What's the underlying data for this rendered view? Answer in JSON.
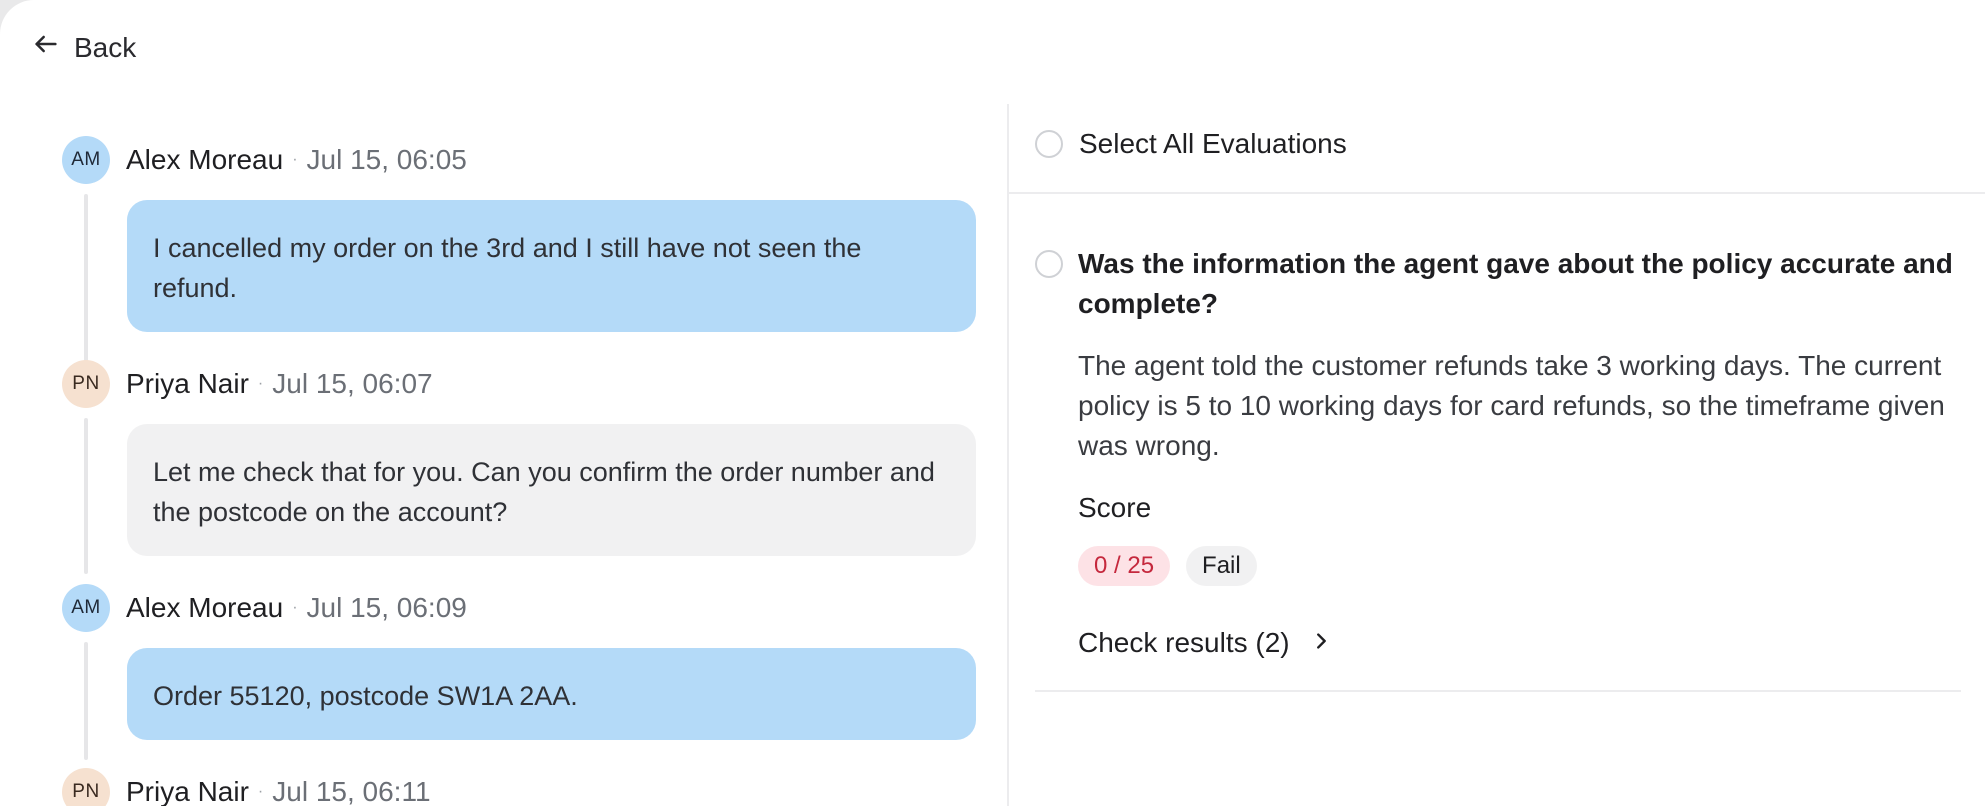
{
  "nav": {
    "back_label": "Back"
  },
  "conversation": {
    "messages": [
      {
        "initials": "AM",
        "author": "Alex Moreau",
        "time": "Jul 15, 06:05",
        "text": "I cancelled my order on the 3rd and I still have not seen the refund.",
        "role": "customer"
      },
      {
        "initials": "PN",
        "author": "Priya Nair",
        "time": "Jul 15, 06:07",
        "text": "Let me check that for you. Can you confirm the order number and the postcode on the account?",
        "role": "agent"
      },
      {
        "initials": "AM",
        "author": "Alex Moreau",
        "time": "Jul 15, 06:09",
        "text": "Order 55120, postcode SW1A 2AA.",
        "role": "customer"
      },
      {
        "initials": "PN",
        "author": "Priya Nair",
        "time": "Jul 15, 06:11",
        "text": "",
        "role": "agent"
      }
    ],
    "separator": "·"
  },
  "evaluations": {
    "select_all_label": "Select All Evaluations",
    "items": [
      {
        "question": "Was the information the agent gave about the policy accurate and complete?",
        "explanation": "The agent told the customer refunds take 3 working days. The current policy is 5 to 10 working days for card refunds, so the timeframe given was wrong.",
        "score_label": "Score",
        "score": "0 / 25",
        "status": "Fail",
        "check_results_label": "Check results (2)"
      }
    ]
  },
  "colors": {
    "customer_bubble": "#b4daf8",
    "agent_bubble": "#f1f1f2",
    "fail_badge_bg": "#fde2e6",
    "fail_badge_text": "#c5283d"
  }
}
